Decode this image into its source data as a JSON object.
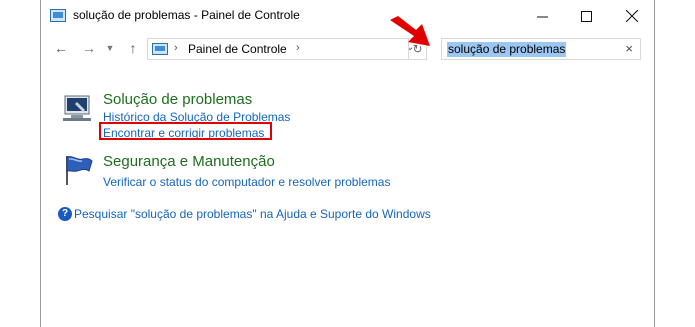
{
  "window": {
    "title": "solução de problemas - Painel de Controle"
  },
  "address_bar": {
    "breadcrumb": "Painel de Controle"
  },
  "search": {
    "value": "solução de problemas",
    "clear_symbol": "×"
  },
  "categories": [
    {
      "title": "Solução de problemas",
      "links": [
        "Histórico da Solução de Problemas",
        "Encontrar e corrigir problemas"
      ]
    },
    {
      "title": "Segurança e Manutenção",
      "links": [
        "Verificar o status do computador e resolver problemas"
      ]
    }
  ],
  "help": {
    "icon_text": "?",
    "text": "Pesquisar \"solução de problemas\" na Ajuda e Suporte do Windows"
  },
  "colors": {
    "category_title": "#1e6e1e",
    "link": "#1565c0",
    "highlight_border": "#e00000",
    "annotation_arrow": "#e00000",
    "search_selection": "#9cc7f2"
  }
}
